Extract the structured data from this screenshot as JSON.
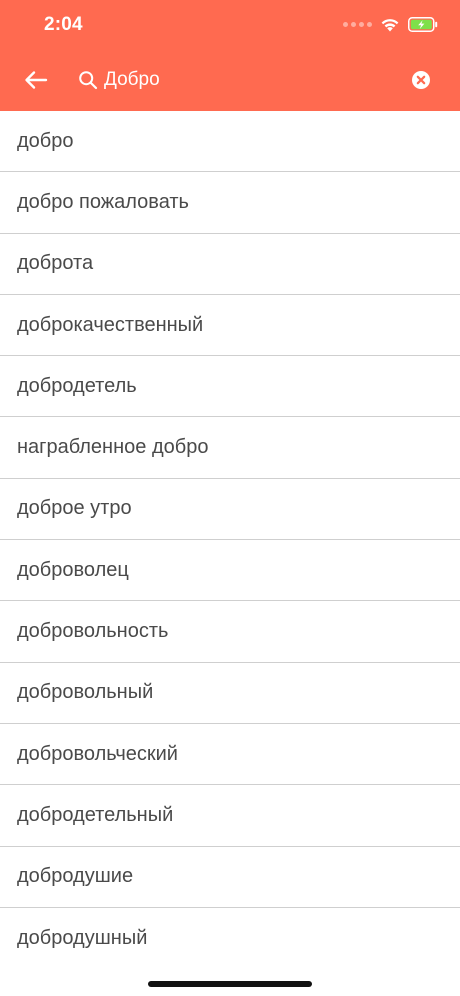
{
  "status_bar": {
    "time": "2:04"
  },
  "search": {
    "query": "Добро",
    "icons": {
      "back": "arrow-left-icon",
      "search": "search-icon",
      "clear": "clear-circle-icon"
    }
  },
  "results": [
    "добро",
    "добро пожаловать",
    "доброта",
    "доброкачественный",
    "добродетель",
    "награбленное добро",
    "доброе утро",
    "доброволец",
    "добровольность",
    "добровольный",
    "добровольческий",
    "добродетельный",
    "добродушие",
    "добродушный"
  ],
  "colors": {
    "header": "#ff6a50",
    "text": "#4a4a4a",
    "divider": "#cfcfcf",
    "battery": "#7ee04a"
  }
}
